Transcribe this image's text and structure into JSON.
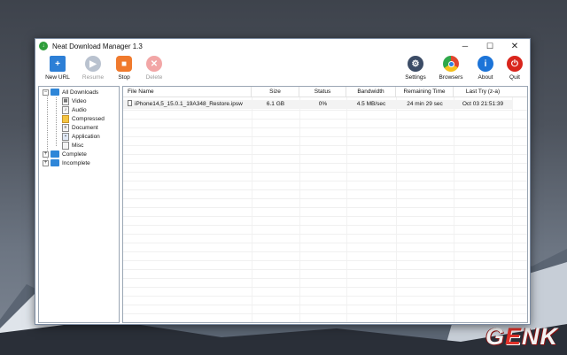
{
  "window": {
    "title": "Neat Download Manager 1.3"
  },
  "window_controls": {
    "minimize": "─",
    "maximize": "☐",
    "close": "✕"
  },
  "toolbar": {
    "new_url": "New URL",
    "resume": "Resume",
    "stop": "Stop",
    "delete": "Delete",
    "settings": "Settings",
    "browsers": "Browsers",
    "about": "About",
    "quit": "Quit"
  },
  "tree": {
    "all_downloads": "All Downloads",
    "children": [
      "Video",
      "Audio",
      "Compressed",
      "Document",
      "Application",
      "Misc"
    ],
    "complete": "Complete",
    "incomplete": "Incomplete"
  },
  "list": {
    "columns": [
      "File Name",
      "Size",
      "Status",
      "Bandwidth",
      "Remaining Time",
      "Last Try (z-a)"
    ],
    "rows": [
      {
        "file_name": "iPhone14,5_15.0.1_19A348_Restore.ipsw",
        "size": "6.1 GB",
        "status": "0%",
        "bandwidth": "4.5 MB/sec",
        "remaining": "24 min  29 sec",
        "last_try": "Oct 03  21:51:39"
      }
    ]
  },
  "watermark": "GENK",
  "colors": {
    "new_url_icon": "#2d7fd6",
    "resume_icon": "#b9c2cf",
    "stop_icon": "#f07a2d",
    "delete_icon": "#f2a6a6",
    "browsers_icon": "#e0462f",
    "about_icon": "#1c74d8",
    "quit_icon": "#d9251c",
    "folder": "#2e86d8",
    "selected_row": "#f3f3f3"
  }
}
